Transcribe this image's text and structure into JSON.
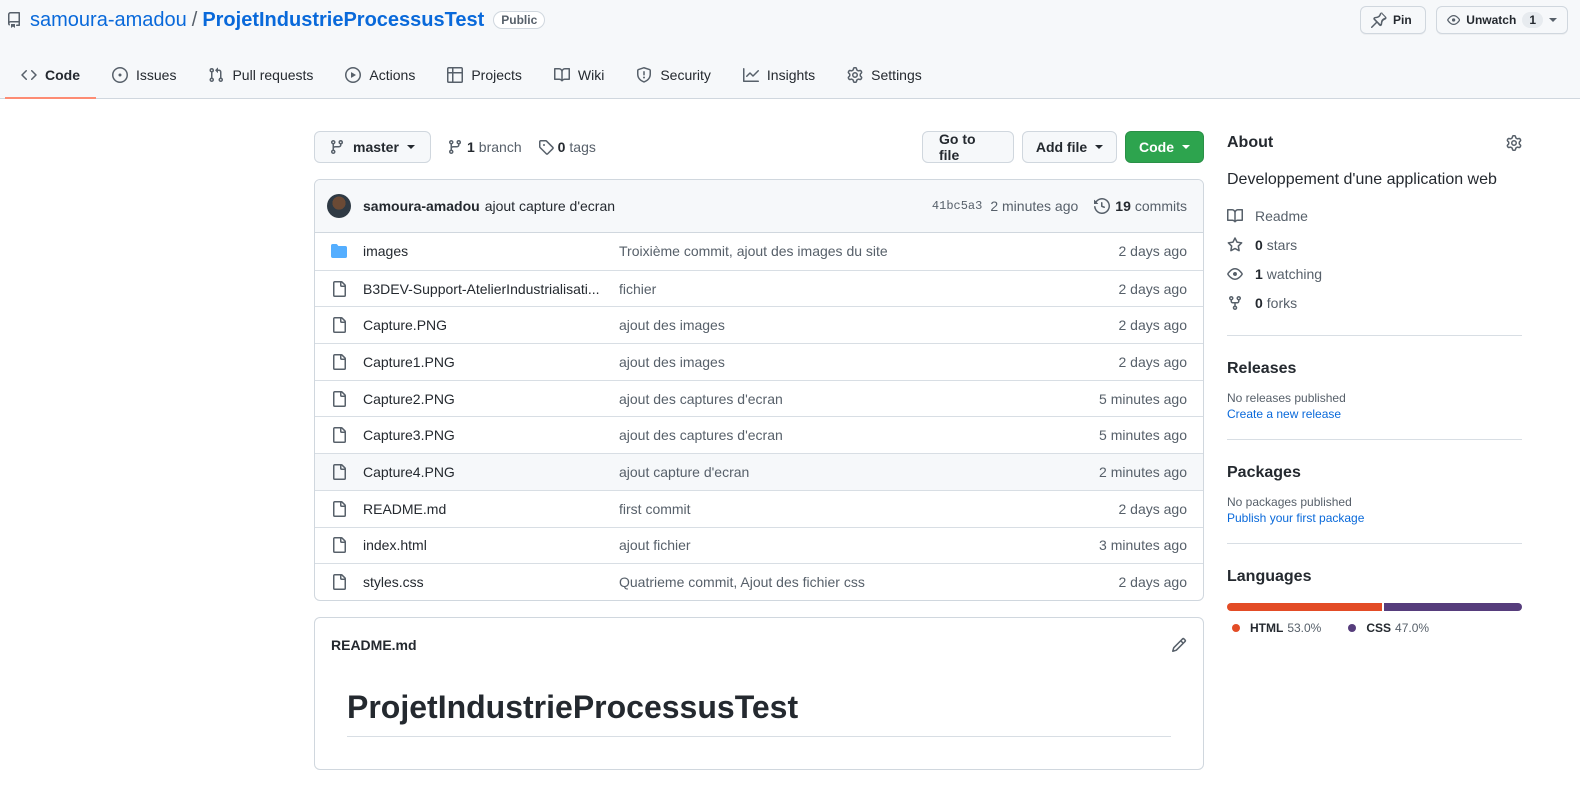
{
  "repo": {
    "owner": "samoura-amadou",
    "separator": "/",
    "name": "ProjetIndustrieProcessusTest",
    "visibility": "Public"
  },
  "header_actions": {
    "pin_label": "Pin",
    "watch_label": "Unwatch",
    "watch_count": "1"
  },
  "tabs": [
    {
      "label": "Code",
      "icon": "code-icon",
      "selected": true
    },
    {
      "label": "Issues",
      "icon": "issue-opened-icon"
    },
    {
      "label": "Pull requests",
      "icon": "git-pull-request-icon"
    },
    {
      "label": "Actions",
      "icon": "play-icon"
    },
    {
      "label": "Projects",
      "icon": "table-icon"
    },
    {
      "label": "Wiki",
      "icon": "book-icon"
    },
    {
      "label": "Security",
      "icon": "shield-icon"
    },
    {
      "label": "Insights",
      "icon": "graph-icon"
    },
    {
      "label": "Settings",
      "icon": "gear-icon"
    }
  ],
  "toolbar": {
    "branch": "master",
    "branch_count": "1",
    "branch_label": "branch",
    "tag_count": "0",
    "tag_label": "tags",
    "go_to_file": "Go to file",
    "add_file": "Add file",
    "code": "Code"
  },
  "commit": {
    "author": "samoura-amadou",
    "message": "ajout capture d'ecran",
    "sha": "41bc5a3",
    "time": "2 minutes ago",
    "count": "19",
    "count_label": "commits"
  },
  "files": [
    {
      "name": "images",
      "type": "folder",
      "message": "Troixième commit, ajout des images du site",
      "date": "2 days ago"
    },
    {
      "name": "B3DEV-Support-AtelierIndustrialisati...",
      "type": "file",
      "message": "fichier",
      "date": "2 days ago"
    },
    {
      "name": "Capture.PNG",
      "type": "file",
      "message": "ajout des images",
      "date": "2 days ago"
    },
    {
      "name": "Capture1.PNG",
      "type": "file",
      "message": "ajout des images",
      "date": "2 days ago"
    },
    {
      "name": "Capture2.PNG",
      "type": "file",
      "message": "ajout des captures d'ecran",
      "date": "5 minutes ago"
    },
    {
      "name": "Capture3.PNG",
      "type": "file",
      "message": "ajout des captures d'ecran",
      "date": "5 minutes ago"
    },
    {
      "name": "Capture4.PNG",
      "type": "file",
      "message": "ajout capture d'ecran",
      "date": "2 minutes ago"
    },
    {
      "name": "README.md",
      "type": "file",
      "message": "first commit",
      "date": "2 days ago"
    },
    {
      "name": "index.html",
      "type": "file",
      "message": "ajout fichier",
      "date": "3 minutes ago"
    },
    {
      "name": "styles.css",
      "type": "file",
      "message": "Quatrieme commit, Ajout des fichier css",
      "date": "2 days ago"
    }
  ],
  "readme": {
    "filename": "README.md",
    "heading": "ProjetIndustrieProcessusTest"
  },
  "about": {
    "title": "About",
    "description": "Developpement d'une application web",
    "readme_label": "Readme",
    "stars_count": "0",
    "stars_label": "stars",
    "watching_count": "1",
    "watching_label": "watching",
    "forks_count": "0",
    "forks_label": "forks"
  },
  "releases": {
    "title": "Releases",
    "empty_text": "No releases published",
    "link": "Create a new release"
  },
  "packages": {
    "title": "Packages",
    "empty_text": "No packages published",
    "link": "Publish your first package"
  },
  "languages": {
    "title": "Languages",
    "items": [
      {
        "name": "HTML",
        "percent": "53.0%",
        "color": "#e34c26",
        "share": 53.0
      },
      {
        "name": "CSS",
        "percent": "47.0%",
        "color": "#563d7c",
        "share": 47.0
      }
    ]
  },
  "colors": {
    "accent": "#0969da",
    "code_button": "#2da44e",
    "tab_underline": "#fd8c73",
    "folder": "#54aeff"
  }
}
